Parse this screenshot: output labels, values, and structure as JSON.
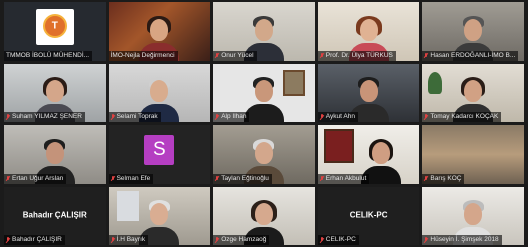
{
  "app": "video-conference-gallery",
  "accent": "#d6d64a",
  "muted_icon": "microphone-muted-icon",
  "tiles": [
    {
      "name": "TMMOB İBOLÜ MÜHENDİ...",
      "muted": false,
      "kind": "logo",
      "logo_text": "T"
    },
    {
      "name": "İMO-Nejla Değirmenci",
      "muted": false,
      "kind": "video"
    },
    {
      "name": "Onur Yücel",
      "muted": true,
      "kind": "video"
    },
    {
      "name": "Prof. Dr. Ülya TÜRKUS",
      "muted": true,
      "kind": "video",
      "speaking": true
    },
    {
      "name": "Hasan ERDOĞANLI-İMO B...",
      "muted": true,
      "kind": "video"
    },
    {
      "name": "Suham YILMAZ ŞENER",
      "muted": true,
      "kind": "video"
    },
    {
      "name": "Selami Toprak",
      "muted": true,
      "kind": "video"
    },
    {
      "name": "Alp Ilhan",
      "muted": true,
      "kind": "video"
    },
    {
      "name": "Aykut Ahn",
      "muted": true,
      "kind": "video"
    },
    {
      "name": "Tomay Kadarcı KOÇAK",
      "muted": true,
      "kind": "video"
    },
    {
      "name": "Ertan Uğur Arslan",
      "muted": true,
      "kind": "video"
    },
    {
      "name": "Selman Efe",
      "muted": true,
      "kind": "avatar",
      "avatar_letter": "S"
    },
    {
      "name": "Taylan Eğtinoğlu",
      "muted": true,
      "kind": "video"
    },
    {
      "name": "Erhan Akbulut",
      "muted": true,
      "kind": "video"
    },
    {
      "name": "Barış KOÇ",
      "muted": true,
      "kind": "video"
    },
    {
      "name": "Bahadır ÇALIŞIR",
      "muted": true,
      "kind": "nameonly",
      "center_name": "Bahadır ÇALIŞIR"
    },
    {
      "name": "İ.H Bayrık",
      "muted": true,
      "kind": "video"
    },
    {
      "name": "Ozge Hamzaoğ",
      "muted": true,
      "kind": "video"
    },
    {
      "name": "CELIK-PC",
      "muted": true,
      "kind": "nameonly",
      "center_name": "CELIK-PC"
    },
    {
      "name": "Hüseyin İ. Şimşek 2018",
      "muted": true,
      "kind": "video"
    }
  ]
}
